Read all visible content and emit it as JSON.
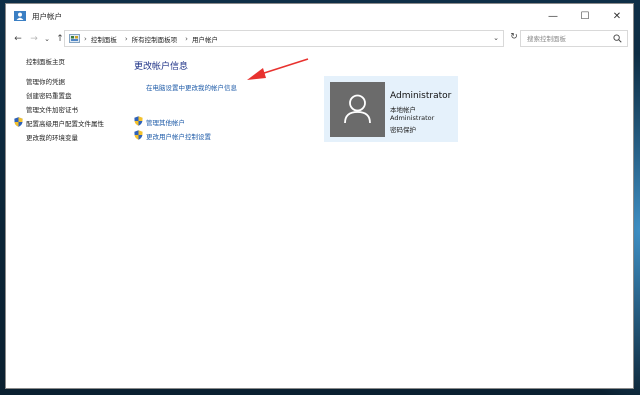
{
  "window": {
    "title": "用户帐户"
  },
  "caption": {
    "minimize": "—",
    "maximize": "☐",
    "close": "✕"
  },
  "nav": {
    "back": "←",
    "forward": "→",
    "recent": "⌄",
    "up": "↑"
  },
  "address": {
    "breadcrumb": [
      "控制面板",
      "所有控制面板项",
      "用户帐户"
    ],
    "separator": "›",
    "dropdown": "⌄",
    "refresh": "↻"
  },
  "search": {
    "placeholder": "搜索控制面板"
  },
  "sidebar": {
    "items": [
      {
        "label": "控制面板主页",
        "shield": false
      },
      {
        "label": "管理你的凭据",
        "shield": false
      },
      {
        "label": "创建密码重置盘",
        "shield": false
      },
      {
        "label": "管理文件加密证书",
        "shield": false
      },
      {
        "label": "配置高级用户配置文件属性",
        "shield": true
      },
      {
        "label": "更改我的环境变量",
        "shield": false
      }
    ]
  },
  "main": {
    "heading": "更改帐户信息",
    "pc_settings_link": "在电脑设置中更改我的帐户信息",
    "actions": [
      {
        "label": "管理其他帐户",
        "shield": true
      },
      {
        "label": "更改用户帐户控制设置",
        "shield": true
      }
    ]
  },
  "account": {
    "name": "Administrator",
    "type": "本地帐户",
    "group": "Administrator",
    "password_status": "密码保护"
  },
  "colors": {
    "link": "#1e5ba8",
    "heading": "#1e3287",
    "card_bg": "#e5f1fb",
    "avatar_bg": "#6b6b6b",
    "annotation_arrow": "#e8322f"
  }
}
